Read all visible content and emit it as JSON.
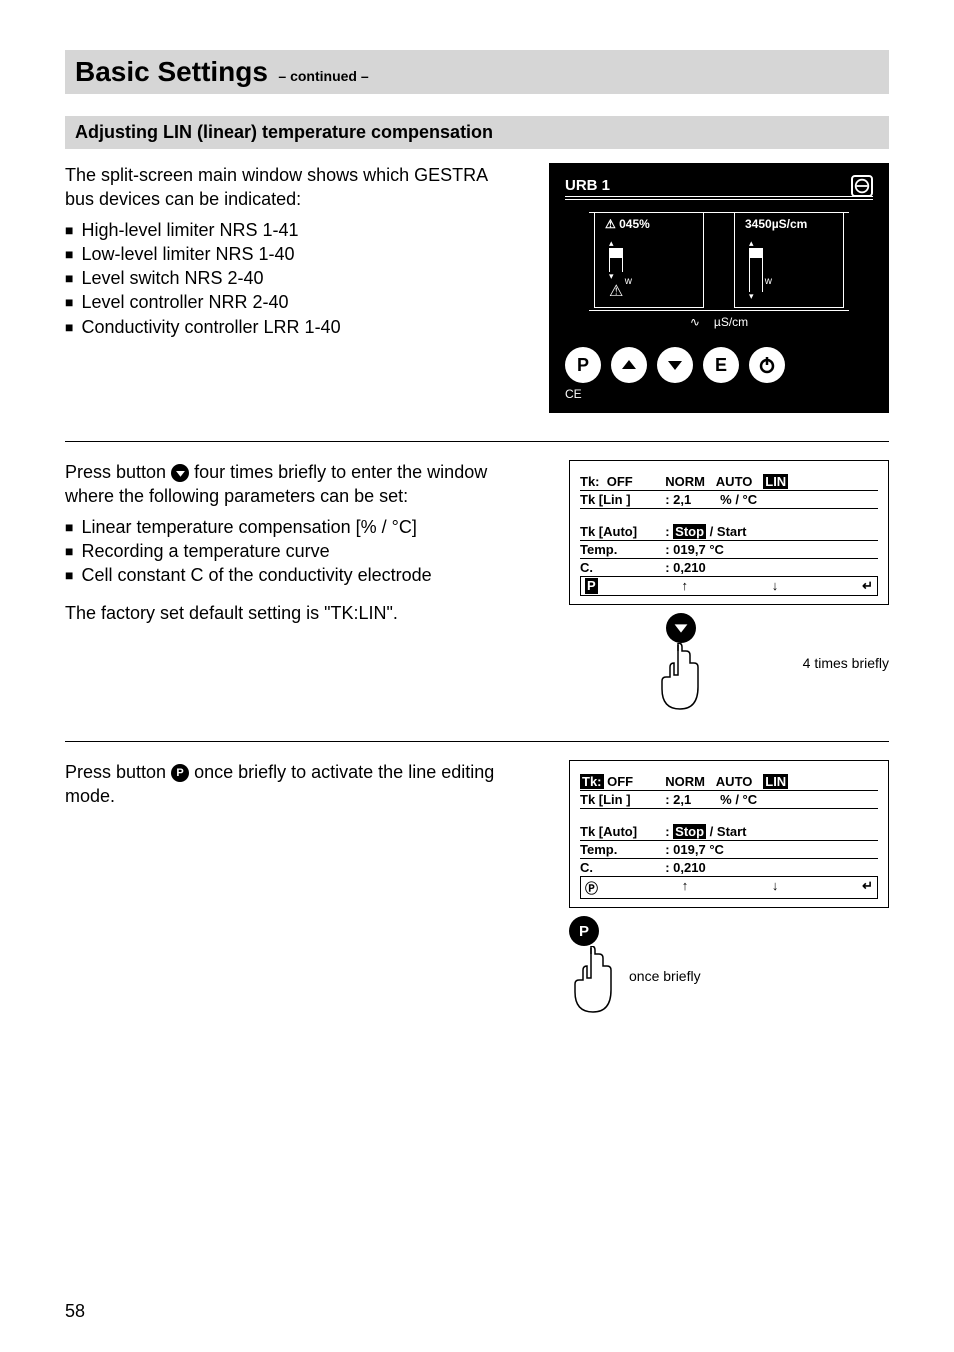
{
  "page_number": "58",
  "title": {
    "main": "Basic Settings",
    "sub": "– continued –"
  },
  "section_heading": "Adjusting LIN (linear) temperature compensation",
  "block1": {
    "intro": "The split-screen main window shows which GESTRA bus devices can be indicated:",
    "bullets": [
      "High-level limiter NRS 1-41",
      "Low-level limiter NRS 1-40",
      "Level switch NRS 2-40",
      "Level controller NRR 2-40",
      "Conductivity controller LRR 1-40"
    ]
  },
  "device": {
    "title": "URB 1",
    "left_val": "045%",
    "right_val": "3450µS/cm",
    "unit_label": "µS/cm",
    "w": "w",
    "ce": "CE",
    "buttons": [
      "P",
      "up",
      "down",
      "E",
      "power"
    ]
  },
  "block2": {
    "text1_a": "Press button ",
    "text1_b": " four times briefly to enter the window where the following parameters can be set:",
    "bullets": [
      "Linear temperature compensation [% / °C]",
      "Recording a temperature curve",
      "Cell constant C of the conductivity electrode"
    ],
    "bullet3_cont": "electrode",
    "text2": "The factory set default setting is \"TK:LIN\".",
    "hint": "4 times briefly"
  },
  "block3": {
    "text_a": "Press button ",
    "text_b": " once briefly to activate the line editing mode.",
    "hint": "once briefly"
  },
  "param_display": {
    "r1": {
      "tk": "Tk:",
      "off": "OFF",
      "norm": "NORM",
      "auto": "AUTO",
      "lin": "LIN"
    },
    "r2": {
      "l": "Tk [Lin ]",
      "v": ": 2,1",
      "u": "% / °C"
    },
    "r3": {
      "l": "Tk [Auto]",
      "v": ": Stop / Start",
      "stop": "Stop",
      "rest": " / Start"
    },
    "r4": {
      "l": "Temp.",
      "v": ": 019,7 °C"
    },
    "r5": {
      "l": "C.",
      "v": ": 0,210"
    },
    "nav": {
      "p": "P",
      "up": "↑",
      "down": "↓",
      "enter": "↵"
    }
  }
}
